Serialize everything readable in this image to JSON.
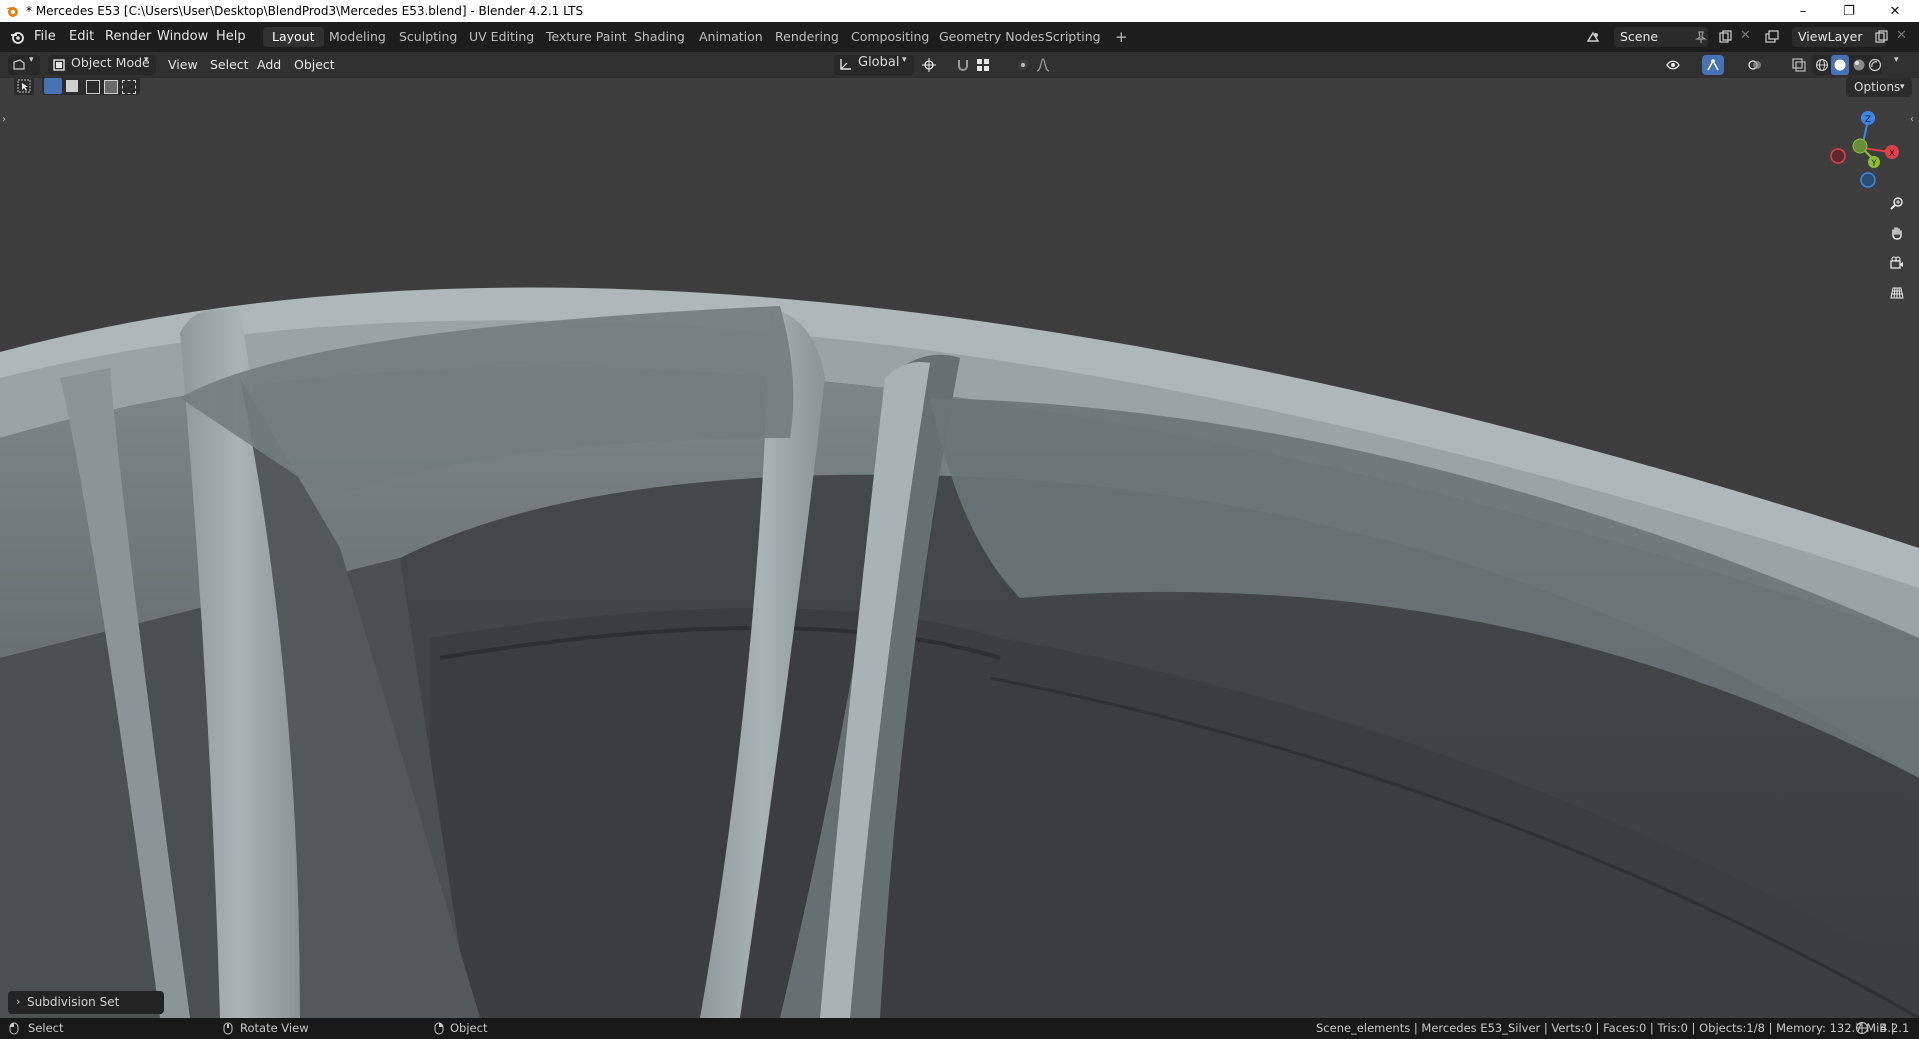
{
  "window": {
    "title": "* Mercedes E53 [C:\\Users\\User\\Desktop\\BlendProd3\\Mercedes E53.blend] - Blender 4.2.1 LTS",
    "minimize": "–",
    "restore": "❐",
    "close": "✕"
  },
  "menu": {
    "file": "File",
    "edit": "Edit",
    "render": "Render",
    "window": "Window",
    "help": "Help"
  },
  "workspaces": [
    "Layout",
    "Modeling",
    "Sculpting",
    "UV Editing",
    "Texture Paint",
    "Shading",
    "Animation",
    "Rendering",
    "Compositing",
    "Geometry Nodes",
    "Scripting"
  ],
  "active_workspace": "Layout",
  "add_workspace": "+",
  "scene": {
    "name": "Scene",
    "view_layer": "ViewLayer"
  },
  "header": {
    "mode": "Object Mode",
    "view": "View",
    "select": "Select",
    "add": "Add",
    "object": "Object",
    "orientation": "Global",
    "options": "Options"
  },
  "gizmo": {
    "z": "Z",
    "y": "Y",
    "x": "X"
  },
  "redo_panel": {
    "label": "Subdivision Set",
    "arrow": "›"
  },
  "status": {
    "select": "Select",
    "rotate": "Rotate View",
    "object": "Object",
    "stats": "Scene_elements | Mercedes E53_Silver | Verts:0 | Faces:0 | Tris:0 | Objects:1/8 | Memory: 132.7 MiB |",
    "version": "4.2.1"
  },
  "colors": {
    "accent_blue": "#4772b3",
    "axis_x": "#e0404c",
    "axis_y": "#8cc034",
    "axis_z": "#3d86e6"
  }
}
